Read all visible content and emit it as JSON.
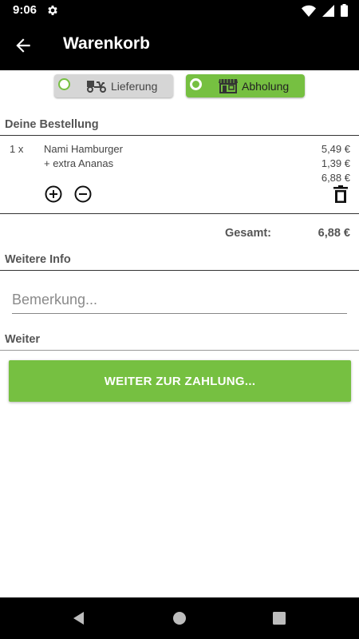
{
  "status_bar": {
    "time": "9:06",
    "icons": [
      "settings-icon",
      "wifi-icon",
      "signal-icon",
      "battery-icon"
    ]
  },
  "app_bar": {
    "title": "Warenkorb",
    "back_icon": "arrow-back-icon"
  },
  "delivery_toggle": {
    "options": [
      {
        "label": "Lieferung",
        "icon": "delivery-scooter-icon",
        "selected": false
      },
      {
        "label": "Abholung",
        "icon": "storefront-icon",
        "selected": true
      }
    ]
  },
  "order": {
    "heading": "Deine Bestellung",
    "items": [
      {
        "quantity": "1 x",
        "name": "Nami Hamburger",
        "price": "5,49 €",
        "extra": "+ extra Ananas",
        "extra_price": "1,39 €",
        "subtotal": "6,88 €"
      }
    ],
    "total_label": "Gesamt:",
    "total_value": "6,88 €"
  },
  "info": {
    "heading": "Weitere Info",
    "note_placeholder": "Bemerkung...",
    "note_value": ""
  },
  "continue": {
    "heading": "Weiter",
    "button_label": "WEITER ZUR ZAHLUNG..."
  },
  "colors": {
    "accent": "#76c041",
    "bar": "#000000",
    "toggle_off": "#d6d6d6"
  },
  "nav_bar": {
    "icons": [
      "back-triangle-icon",
      "home-circle-icon",
      "recents-square-icon"
    ]
  }
}
